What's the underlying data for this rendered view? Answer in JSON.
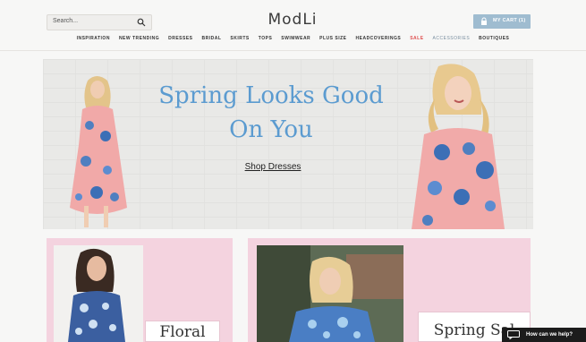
{
  "header": {
    "search_placeholder": "Search...",
    "logo": "ModLi",
    "cart_label": "MY CART (1)"
  },
  "nav": {
    "items": [
      "INSPIRATION",
      "NEW TRENDING",
      "DRESSES",
      "BRIDAL",
      "SKIRTS",
      "TOPS",
      "SWIMWEAR",
      "PLUS SIZE",
      "HEADCOVERINGS",
      "SALE",
      "ACCESSORIES",
      "BOUTIQUES"
    ]
  },
  "hero": {
    "headline_line1": "Spring Looks Good",
    "headline_line2": "On You",
    "cta": "Shop Dresses"
  },
  "cards": {
    "left_label": "Floral",
    "right_label": "Spring Sal"
  },
  "help": {
    "label": "How can we help?"
  },
  "colors": {
    "accent_blue": "#5b9bd0",
    "cart_blue": "#9fbcd0",
    "card_pink": "#f4d3df",
    "sale_red": "#e05050"
  }
}
